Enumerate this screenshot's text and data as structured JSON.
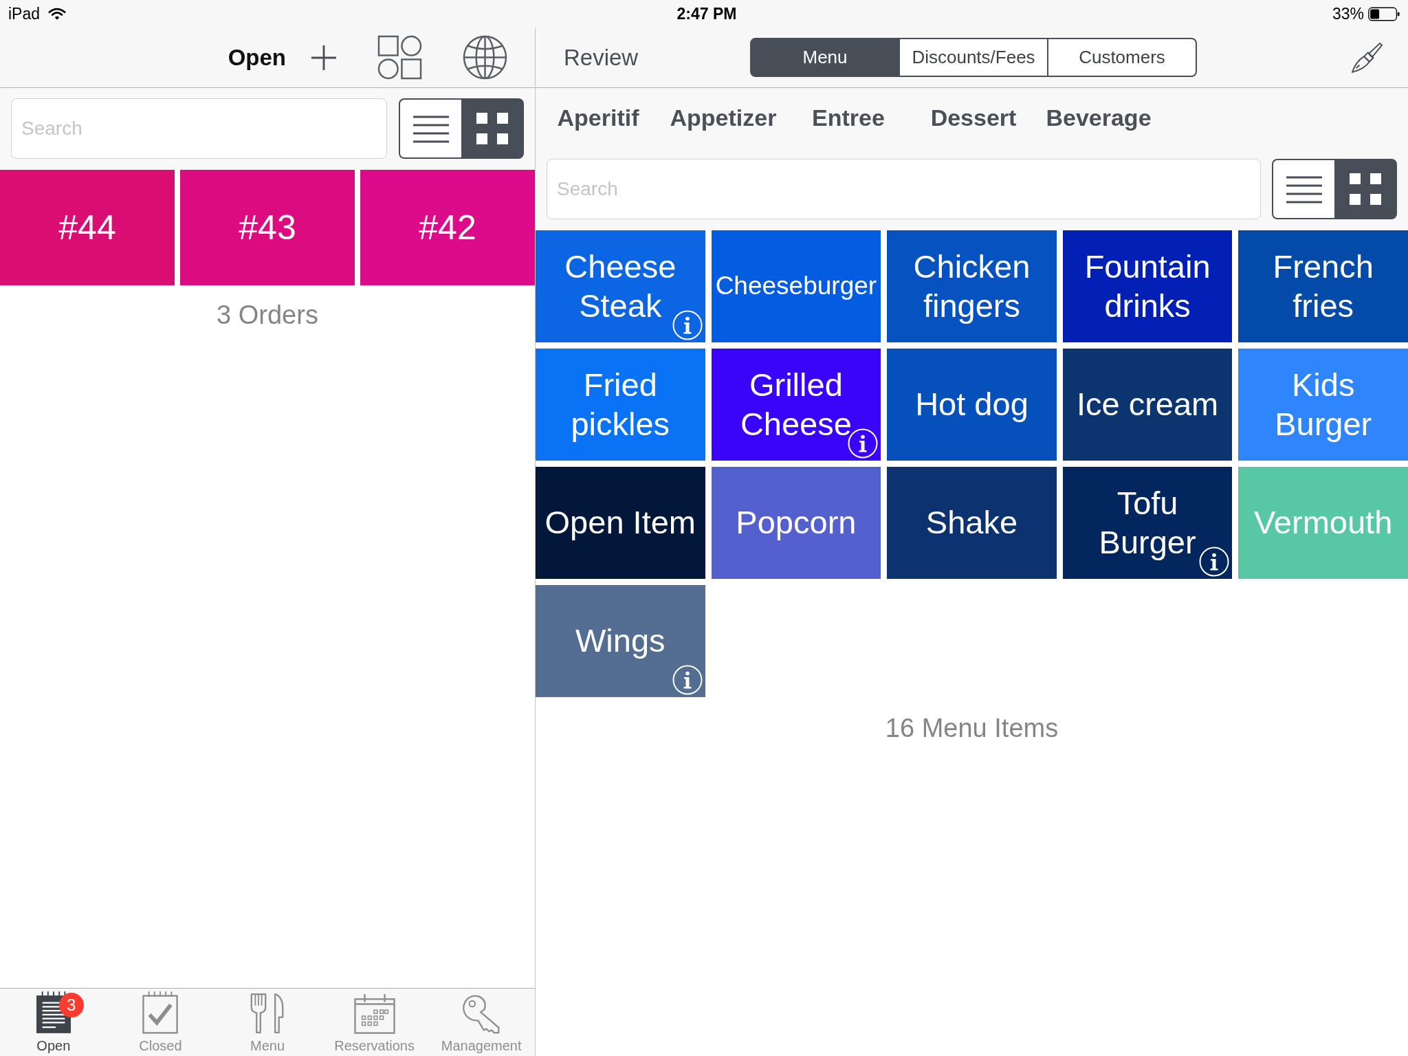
{
  "status_bar": {
    "device": "iPad",
    "time": "2:47 PM",
    "battery": "33%"
  },
  "orders_pane": {
    "title": "Open",
    "search": {
      "placeholder": "Search"
    },
    "view_toggle": [
      {
        "kind": "list",
        "selected": false
      },
      {
        "kind": "grid",
        "selected": true
      }
    ],
    "orders": [
      {
        "label": "#44",
        "color": "#d90d72"
      },
      {
        "label": "#43",
        "color": "#dc0b80"
      },
      {
        "label": "#42",
        "color": "#dc0b8a"
      }
    ],
    "count": "3 Orders"
  },
  "review_pane": {
    "title": "Review",
    "segments": [
      {
        "label": "Menu",
        "selected": true
      },
      {
        "label": "Discounts/Fees",
        "selected": false
      },
      {
        "label": "Customers",
        "selected": false
      }
    ],
    "categories": [
      "Aperitif",
      "Appetizer",
      "Entree",
      "Dessert",
      "Beverage"
    ],
    "search": {
      "placeholder": "Search"
    },
    "view_toggle": [
      {
        "kind": "list",
        "selected": false
      },
      {
        "kind": "grid",
        "selected": true
      }
    ],
    "items": [
      {
        "name": "Cheese Steak",
        "color": "#0c66e4",
        "info": true
      },
      {
        "name": "Cheeseburger",
        "color": "#045de0",
        "info": false
      },
      {
        "name": "Chicken fingers",
        "color": "#0552c0",
        "info": false
      },
      {
        "name": "Fountain drinks",
        "color": "#0320b5",
        "info": false
      },
      {
        "name": "French fries",
        "color": "#044aa8",
        "info": false
      },
      {
        "name": "Fried pickles",
        "color": "#0a72f4",
        "info": false
      },
      {
        "name": "Grilled Cheese",
        "color": "#3a04f9",
        "info": true
      },
      {
        "name": "Hot dog",
        "color": "#0550ba",
        "info": false
      },
      {
        "name": "Ice cream",
        "color": "#0c346e",
        "info": false
      },
      {
        "name": "Kids Burger",
        "color": "#2f85fb",
        "info": false
      },
      {
        "name": "Open Item",
        "color": "#02173a",
        "info": false
      },
      {
        "name": "Popcorn",
        "color": "#5560cf",
        "info": false
      },
      {
        "name": "Shake",
        "color": "#0c336f",
        "info": false
      },
      {
        "name": "Tofu Burger",
        "color": "#03265f",
        "info": true
      },
      {
        "name": "Vermouth",
        "color": "#57c8a3",
        "info": false
      },
      {
        "name": "Wings",
        "color": "#536e92",
        "info": true
      }
    ],
    "count": "16 Menu Items"
  },
  "tab_bar": [
    {
      "label": "Open",
      "kind": "notepad",
      "selected": true,
      "badge": "3"
    },
    {
      "label": "Closed",
      "kind": "checked-notepad",
      "selected": false
    },
    {
      "label": "Menu",
      "kind": "fork-knife",
      "selected": false
    },
    {
      "label": "Reservations",
      "kind": "calendar",
      "selected": false
    },
    {
      "label": "Management",
      "kind": "key",
      "selected": false
    }
  ]
}
